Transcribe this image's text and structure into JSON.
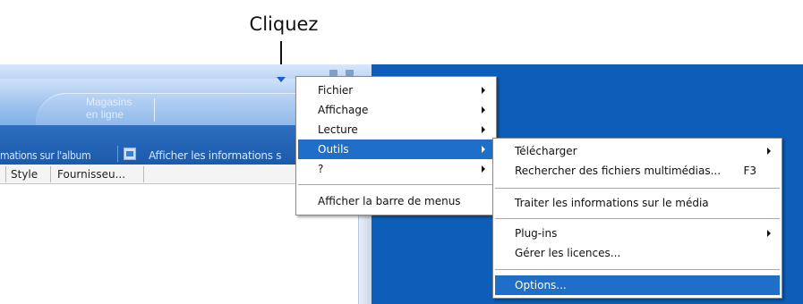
{
  "callout": {
    "label": "Cliquez"
  },
  "app": {
    "store_line1": "Magasins",
    "store_line2": "en ligne",
    "info_album": "mations sur l'album",
    "info_show": "Afficher les informations s",
    "columns": [
      "Style",
      "Fournisseu..."
    ]
  },
  "main_menu": {
    "items": [
      {
        "label": "Fichier"
      },
      {
        "label": "Affichage"
      },
      {
        "label": "Lecture"
      },
      {
        "label": "Outils"
      },
      {
        "label": "?"
      },
      {
        "label": "Afficher la barre de menus"
      }
    ]
  },
  "tools_menu": {
    "items": [
      {
        "label": "Télécharger"
      },
      {
        "label": "Rechercher des fichiers multimédias...",
        "shortcut": "F3"
      },
      {
        "label": "Traiter les informations sur le média"
      },
      {
        "label": "Plug-ins"
      },
      {
        "label": "Gérer les licences..."
      },
      {
        "label": "Options..."
      }
    ]
  },
  "colors": {
    "desktop": "#0d5eb8",
    "highlight": "#1f6fc9"
  }
}
